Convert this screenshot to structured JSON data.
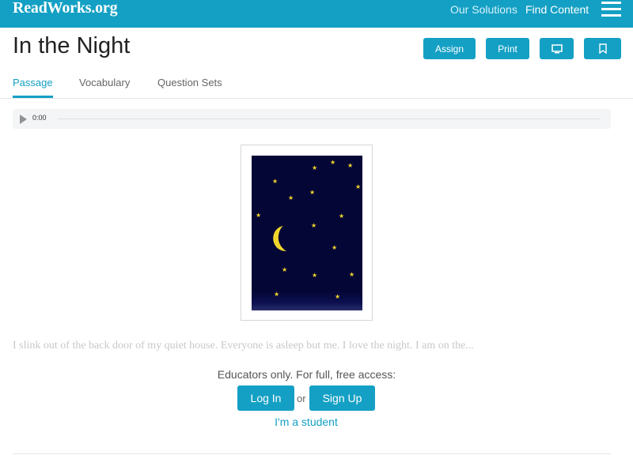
{
  "header": {
    "logo": "ReadWorks.org",
    "nav": {
      "solutions": "Our Solutions",
      "find_content": "Find Content"
    },
    "menu_icon": "hamburger-menu-icon"
  },
  "page": {
    "title": "In the Night",
    "actions": {
      "assign": "Assign",
      "print": "Print",
      "present_icon": "monitor-icon",
      "bookmark_icon": "bookmark-icon"
    },
    "tabs": [
      {
        "label": "Passage",
        "active": true
      },
      {
        "label": "Vocabulary",
        "active": false
      },
      {
        "label": "Question Sets",
        "active": false
      }
    ]
  },
  "audio": {
    "time": "0:00",
    "play_icon": "play-icon"
  },
  "passage": {
    "illustration": "night-sky-illustration",
    "excerpt": "I slink out of the back door of my quiet house. Everyone is asleep but me. I love the night. I am on the..."
  },
  "access": {
    "label": "Educators only. For full, free access:",
    "login": "Log In",
    "or": "or",
    "signup": "Sign Up",
    "student": "I'm a student"
  },
  "colors": {
    "accent": "#14a0c4",
    "sky": "#040636",
    "star": "#f2d52b"
  }
}
